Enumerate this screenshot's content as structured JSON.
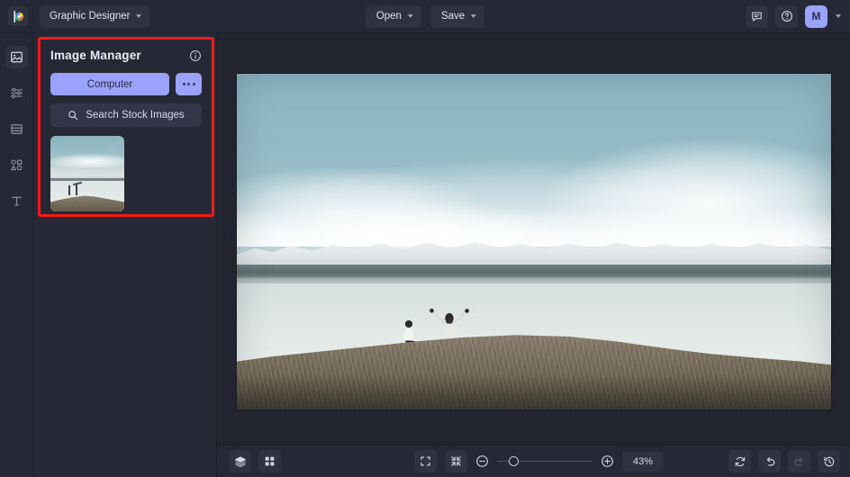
{
  "app": {
    "logo_icon": "color-wheel-logo",
    "document_name": "Graphic Designer"
  },
  "topbar": {
    "open_label": "Open",
    "save_label": "Save",
    "feedback_icon": "comment-icon",
    "help_icon": "help-circle-icon",
    "avatar_initial": "M",
    "account_chevron_icon": "chevron-down-icon"
  },
  "rail": {
    "items": [
      {
        "icon": "image-icon",
        "name": "image-manager",
        "active": true
      },
      {
        "icon": "sliders-icon",
        "name": "adjustments",
        "active": false
      },
      {
        "icon": "frame-icon",
        "name": "layouts",
        "active": false
      },
      {
        "icon": "shapes-icon",
        "name": "elements",
        "active": false
      },
      {
        "icon": "text-icon",
        "name": "text",
        "active": false
      }
    ]
  },
  "panel": {
    "title": "Image Manager",
    "info_icon": "info-circle-icon",
    "highlight_color": "#f71919",
    "accent_color": "#9aa3fb",
    "computer_label": "Computer",
    "more_icon": "more-horizontal-icon",
    "search_label": "Search Stock Images",
    "search_icon": "search-icon",
    "thumbnails": [
      {
        "name": "lake-mountains-couple",
        "alt": "Couple on bluff overlooking lake and snowy mountains"
      }
    ]
  },
  "canvas": {
    "image_alt": "Two people standing on a grassy bluff above a calm lake with snow-capped mountains"
  },
  "bottombar": {
    "layers_icon": "layers-icon",
    "grid_icon": "grid-icon",
    "fit_icon": "fit-screen-icon",
    "shrink_icon": "collapse-icon",
    "zoom_out_icon": "minus-circle-icon",
    "zoom_in_icon": "plus-circle-icon",
    "zoom_value": "43%",
    "slider_position_percent": 12,
    "reset_icon": "reset-icon",
    "undo_icon": "undo-icon",
    "redo_icon": "redo-icon",
    "history_icon": "history-icon"
  }
}
